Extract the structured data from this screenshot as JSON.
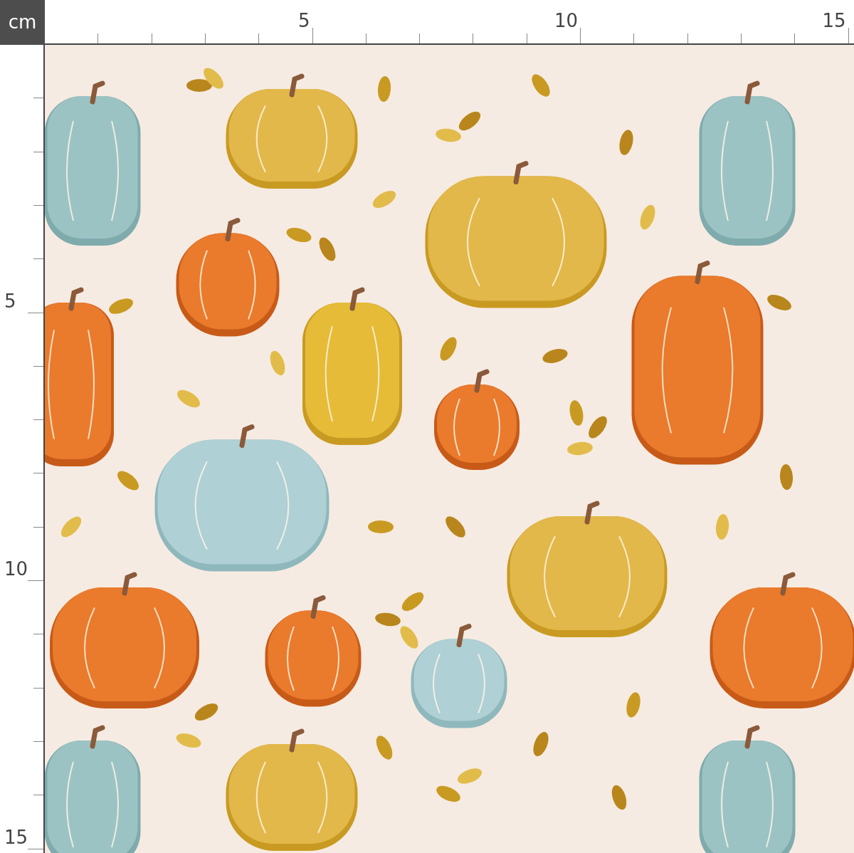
{
  "unit": "cm",
  "top_ruler": {
    "labels": [
      "5",
      "10",
      "15"
    ]
  },
  "left_ruler": {
    "labels": [
      "5",
      "10",
      "15"
    ]
  }
}
